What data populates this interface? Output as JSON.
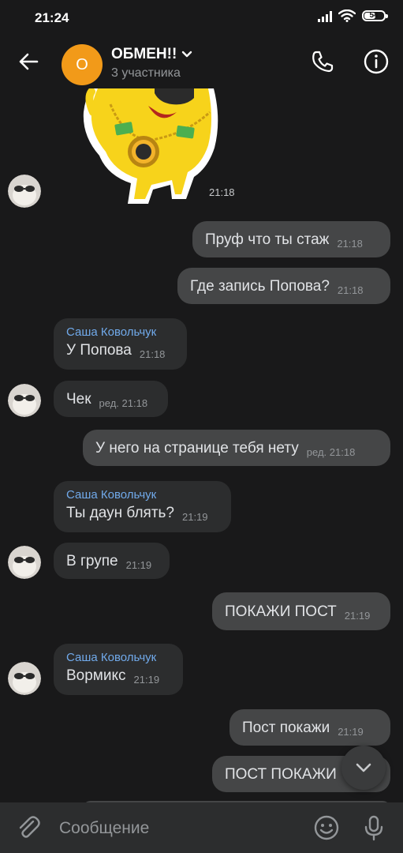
{
  "status_bar": {
    "time": "21:24",
    "battery_level": "54"
  },
  "header": {
    "avatar_letter": "О",
    "title": "ОБМЕН!!",
    "subtitle": "3 участника",
    "back_icon": "arrow-left-icon",
    "call_icon": "phone-icon",
    "info_icon": "info-icon"
  },
  "messages": [
    {
      "type": "sticker",
      "time": "21:18"
    },
    {
      "type": "out",
      "text": "Пруф что ты стаж",
      "time": "21:18"
    },
    {
      "type": "out",
      "text": "Где запись Попова?",
      "time": "21:18"
    },
    {
      "type": "in",
      "sender": "Саша Ковольчук",
      "text": "У Попова",
      "time": "21:18"
    },
    {
      "type": "in",
      "text": "Чек",
      "time": "ред. 21:18"
    },
    {
      "type": "out",
      "text": "У него на странице тебя нету",
      "time": "ред. 21:18"
    },
    {
      "type": "in",
      "sender": "Саша Ковольчук",
      "text": "Ты даун блять?",
      "time": "21:19"
    },
    {
      "type": "in",
      "text": "В групе",
      "time": "21:19"
    },
    {
      "type": "out",
      "text": "ПОКАЖИ ПОСТ",
      "time": "21:19"
    },
    {
      "type": "in",
      "sender": "Саша Ковольчук",
      "text": "Вормикс",
      "time": "21:19"
    },
    {
      "type": "out",
      "text": "Пост покажи",
      "time": "21:19"
    },
    {
      "type": "out",
      "text": "ПОСТ ПОКАЖИ",
      "time": ""
    }
  ],
  "composer": {
    "placeholder": "Сообщение"
  },
  "colors": {
    "background": "#19191a",
    "bubble_out": "#454647",
    "bubble_in": "#2c2d2e",
    "sender_name": "#71aaeb",
    "avatar": "#f29a19"
  }
}
